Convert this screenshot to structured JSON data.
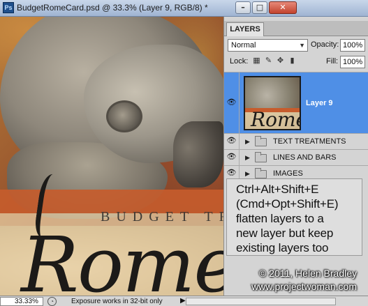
{
  "window": {
    "app_icon": "ps-icon",
    "app_icon_text": "Ps",
    "title": "BudgetRomeCard.psd @ 33.3% (Layer 9, RGB/8) *",
    "minimize_glyph": "–",
    "maximize_glyph": "□",
    "close_glyph": "✕"
  },
  "canvas": {
    "budget_text": "BUDGET TR",
    "rome_text": "Rome"
  },
  "layers_panel": {
    "tab_label": "LAYERS",
    "blend_mode": "Normal",
    "opacity_label": "Opacity:",
    "opacity_value": "100%",
    "lock_label": "Lock:",
    "fill_label": "Fill:",
    "fill_value": "100%",
    "layers": [
      {
        "name": "Layer 9",
        "visible": true,
        "selected": true,
        "type": "layer",
        "thumb_text": "Rome"
      },
      {
        "name": "TEXT TREATMENTS",
        "visible": true,
        "selected": false,
        "type": "group"
      },
      {
        "name": "LINES AND BARS",
        "visible": true,
        "selected": false,
        "type": "group"
      },
      {
        "name": "IMAGES",
        "visible": true,
        "selected": false,
        "type": "group"
      }
    ]
  },
  "callout": {
    "lines": [
      "Ctrl+Alt+Shift+E",
      "(Cmd+Opt+Shift+E)",
      "flatten layers to a",
      "new layer but keep",
      "existing layers too"
    ]
  },
  "watermark": {
    "copyright": "© 2011, Helen Bradley",
    "url": "www.projectwoman.com"
  },
  "statusbar": {
    "zoom": "33.33%",
    "info": "Exposure works in 32-bit only",
    "arrow": "▶"
  }
}
